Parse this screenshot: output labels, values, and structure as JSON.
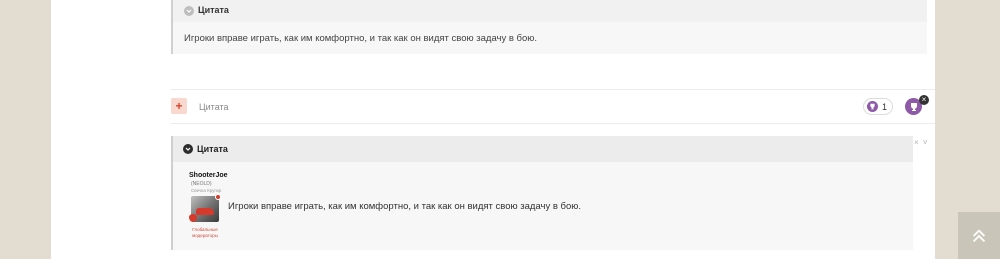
{
  "quotes": [
    {
      "label": "Цитата",
      "text": "Игроки вправе играть, как им комфортно, и так как он видят свою задачу в бою."
    },
    {
      "label": "Цитата",
      "author": {
        "name": "ShooterJoe",
        "rank": "(NEOLD)",
        "subtitle": "Свечка Крупкр",
        "role": "Глобальные модераторы"
      },
      "text": "Игроки вправе играть, как им комфортно, и так как он видят свою задачу в бою."
    }
  ],
  "reply_bar": {
    "add_label": "+",
    "quote_label": "Цитата",
    "reaction_count": "1",
    "close_label": "×"
  },
  "side_controls": "× ˅",
  "icons": {
    "quote_toggle": "chevron-down-icon",
    "reaction": "trophy-icon",
    "scroll_top": "double-chevron-up-icon"
  },
  "colors": {
    "background": "#e2ddd0",
    "accent": "#8e5aa8",
    "add_button": "#f9d8cf"
  }
}
